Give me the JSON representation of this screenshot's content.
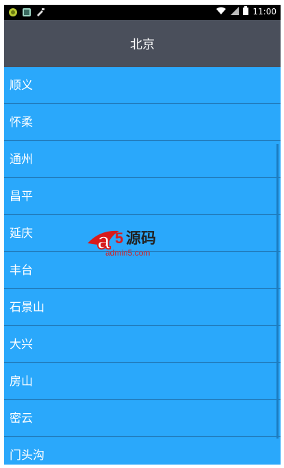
{
  "status_bar": {
    "time": "11:00",
    "left_icons": [
      "android-debug-icon",
      "image-icon",
      "usb-icon"
    ],
    "right_icons": [
      "wifi-icon",
      "signal-icon",
      "battery-icon"
    ]
  },
  "app_bar": {
    "title": "北京"
  },
  "list": {
    "items": [
      "顺义",
      "怀柔",
      "通州",
      "昌平",
      "延庆",
      "丰台",
      "石景山",
      "大兴",
      "房山",
      "密云",
      "门头沟"
    ]
  },
  "watermark": {
    "brand": "a5源码",
    "site": "admin5.com"
  },
  "colors": {
    "app_bar": "#4a4f5b",
    "list_bg": "#2aa8fb",
    "divider": "#1b5f93"
  }
}
